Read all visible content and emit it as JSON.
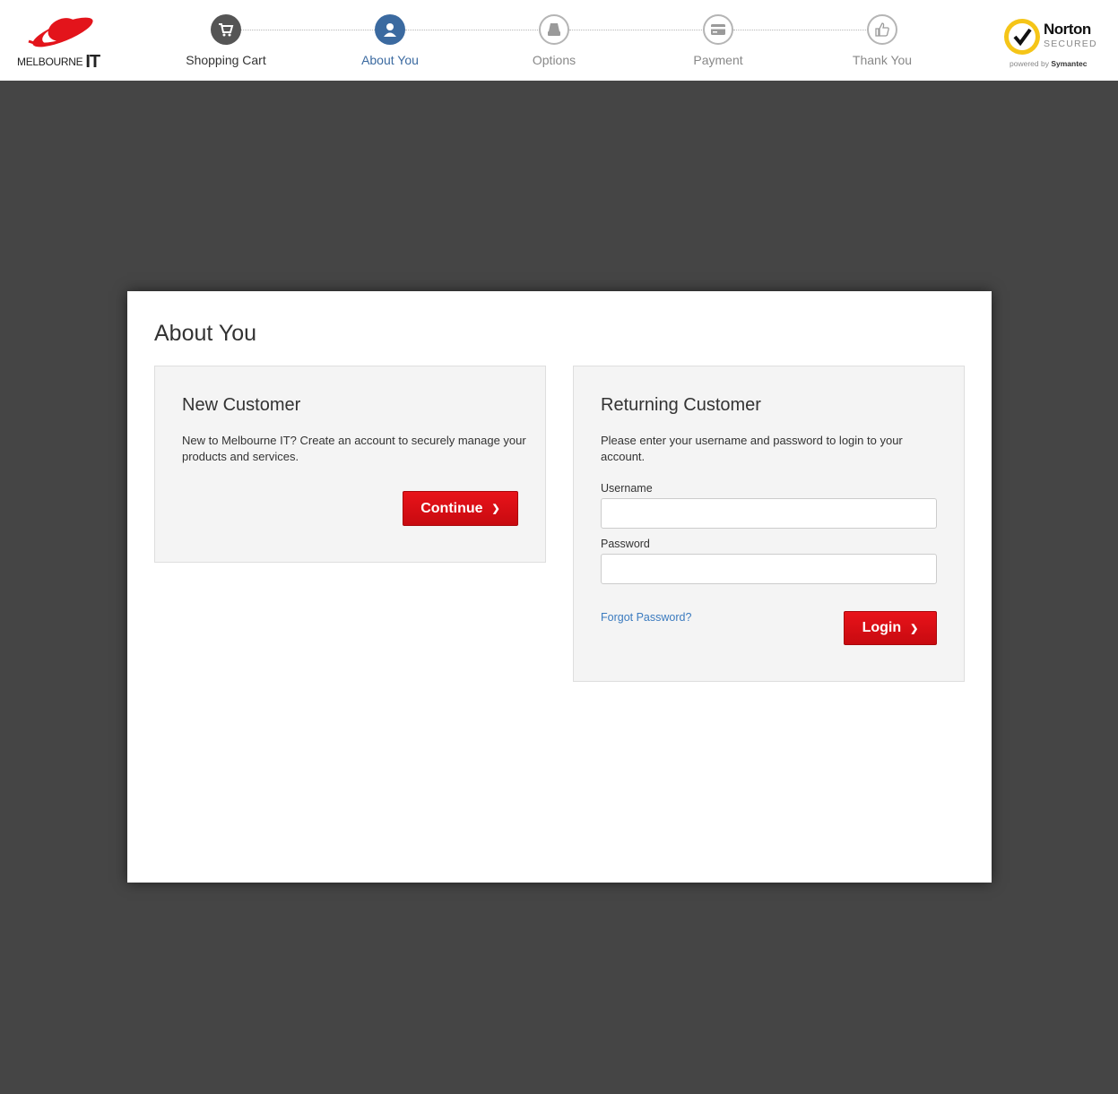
{
  "brand": {
    "logo_text": "MELBOURNE",
    "logo_text_it": "IT",
    "logo_color": "#e3141b"
  },
  "stepper": {
    "steps": [
      {
        "label": "Shopping Cart",
        "state": "done",
        "icon": "cart-icon"
      },
      {
        "label": "About You",
        "state": "active",
        "icon": "user-icon"
      },
      {
        "label": "Options",
        "state": "pending",
        "icon": "drive-icon"
      },
      {
        "label": "Payment",
        "state": "pending",
        "icon": "credit-card-icon"
      },
      {
        "label": "Thank You",
        "state": "pending",
        "icon": "thumbs-up-icon"
      }
    ],
    "active_color": "#3b6aa0",
    "done_color": "#555555",
    "pending_color": "#b5b5b5"
  },
  "norton": {
    "title": "Norton",
    "subtitle": "SECURED",
    "powered_prefix": "powered by",
    "powered_brand": "Symantec",
    "seal_color": "#f5c518"
  },
  "page": {
    "title": "About You"
  },
  "new_customer": {
    "title": "New Customer",
    "description": "New to Melbourne IT? Create an account to securely manage your products and services.",
    "continue_label": "Continue"
  },
  "returning_customer": {
    "title": "Returning Customer",
    "description": "Please enter your username and password to login to your account.",
    "username_label": "Username",
    "username_value": "",
    "password_label": "Password",
    "password_value": "",
    "forgot_label": "Forgot Password?",
    "login_label": "Login"
  },
  "colors": {
    "button_red": "#d90e15",
    "link_blue": "#3b7bbf",
    "backdrop": "#454545"
  }
}
